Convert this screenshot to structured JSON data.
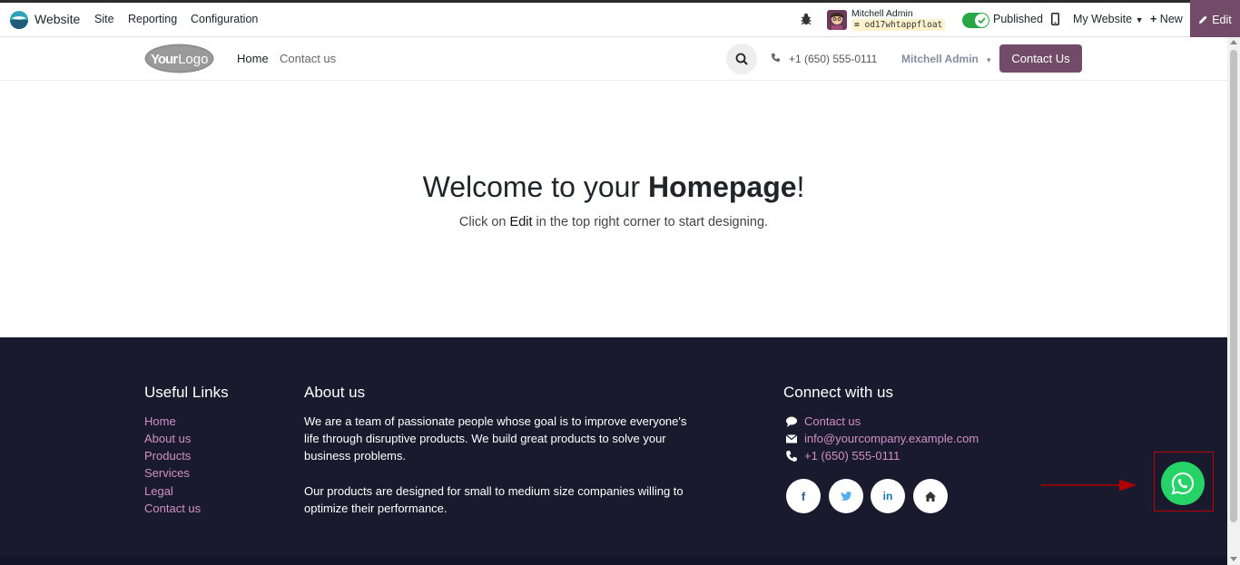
{
  "topbar": {
    "app_name": "Website",
    "menus": [
      "Site",
      "Reporting",
      "Configuration"
    ],
    "user_name": "Mitchell Admin",
    "db_name": "od17whtappfloat",
    "published_label": "Published",
    "my_website_label": "My Website",
    "new_label": "New",
    "edit_label": "Edit",
    "colors": {
      "edit_bg": "#714b67",
      "toggle_on": "#28a745"
    }
  },
  "header": {
    "logo_text": "YourLogo",
    "nav": [
      "Home",
      "Contact us"
    ],
    "phone": "+1 (650) 555-0111",
    "user_menu": "Mitchell Admin",
    "contact_button": "Contact Us"
  },
  "hero": {
    "title_prefix": "Welcome to your ",
    "title_bold": "Homepage",
    "title_suffix": "!",
    "subtitle_prefix": "Click on ",
    "subtitle_em": "Edit",
    "subtitle_suffix": " in the top right corner to start designing."
  },
  "footer": {
    "useful_links_heading": "Useful Links",
    "useful_links": [
      "Home",
      "About us",
      "Products",
      "Services",
      "Legal",
      "Contact us"
    ],
    "about_heading": "About us",
    "about_p1_lines": [
      "We are a team of passionate people whose goal is to improve everyone's",
      "life through disruptive products. We build great products to solve your",
      "business problems."
    ],
    "about_p2_lines": [
      "Our products are designed for small to medium size companies willing to",
      "optimize their performance."
    ],
    "connect_heading": "Connect with us",
    "connect_items": [
      "Contact us",
      "info@yourcompany.example.com",
      "+1 (650) 555-0111"
    ],
    "social_icons": [
      "facebook-icon",
      "twitter-icon",
      "linkedin-icon",
      "home-icon"
    ],
    "colors": {
      "bg": "#1a1a2e",
      "link": "#d18fc7"
    }
  },
  "whatsapp": {
    "icon": "whatsapp-icon",
    "color": "#25d366"
  }
}
